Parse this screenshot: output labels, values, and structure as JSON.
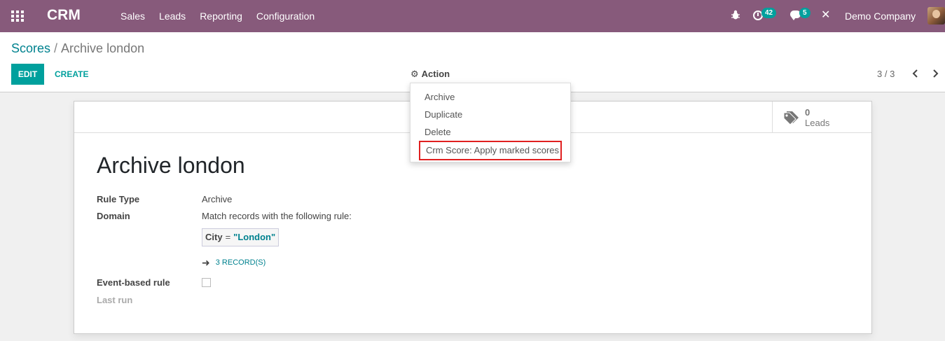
{
  "navbar": {
    "brand": "CRM",
    "menu": [
      "Sales",
      "Leads",
      "Reporting",
      "Configuration"
    ],
    "activity_count": "42",
    "message_count": "5",
    "company": "Demo Company"
  },
  "breadcrumb": {
    "parent": "Scores",
    "separator": "/",
    "current": "Archive london"
  },
  "buttons": {
    "edit": "EDIT",
    "create": "CREATE",
    "action": "Action"
  },
  "pager": {
    "value": "3 / 3"
  },
  "action_menu": {
    "items": [
      "Archive",
      "Duplicate",
      "Delete",
      "Crm Score: Apply marked scores"
    ]
  },
  "form": {
    "stat_button": {
      "value": "0",
      "label": "Leads"
    },
    "title": "Archive london",
    "fields": {
      "rule_type_label": "Rule Type",
      "rule_type_value": "Archive",
      "domain_label": "Domain",
      "domain_description": "Match records with the following rule:",
      "domain_field": "City",
      "domain_operator": "=",
      "domain_value": "\"London\"",
      "records_link": "3 RECORD(S)",
      "event_based_label": "Event-based rule",
      "event_based_checked": false,
      "last_run_label": "Last run"
    }
  },
  "colors": {
    "navbar": "#875a7b",
    "primary": "#00a09d",
    "link": "#00828f",
    "highlight_border": "#e02020"
  }
}
